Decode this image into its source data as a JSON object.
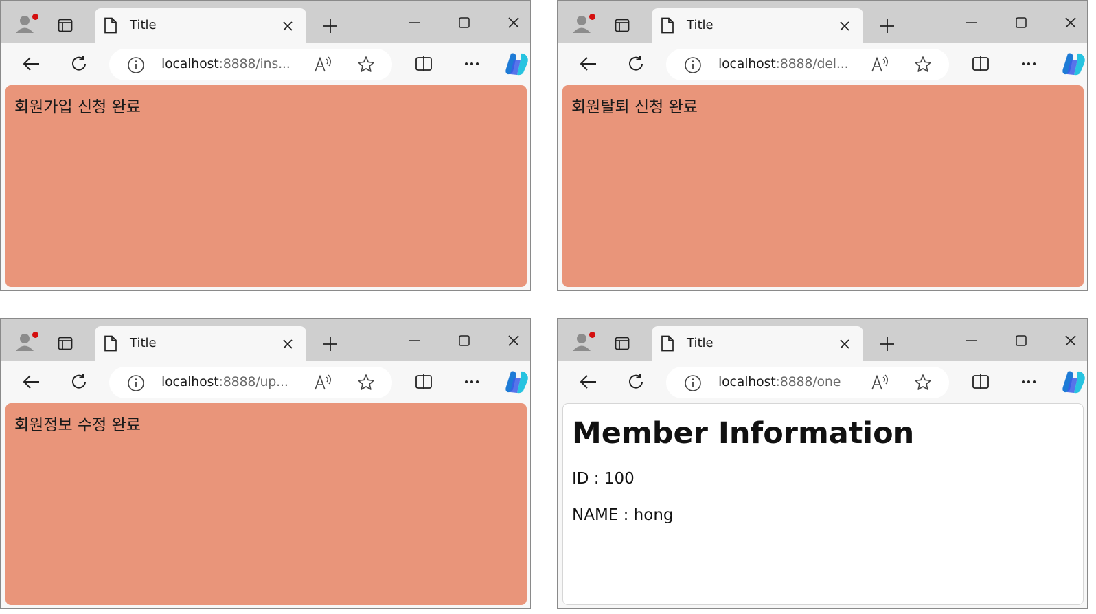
{
  "windows": [
    {
      "tab_title": "Title",
      "url_host": "localhost",
      "url_rest": ":8888/ins...",
      "message": "회원가입 신청 완료"
    },
    {
      "tab_title": "Title",
      "url_host": "localhost",
      "url_rest": ":8888/del...",
      "message": "회원탈퇴 신청 완료"
    },
    {
      "tab_title": "Title",
      "url_host": "localhost",
      "url_rest": ":8888/up...",
      "message": "회원정보 수정 완료"
    },
    {
      "tab_title": "Title",
      "url_host": "localhost",
      "url_rest": ":8888/one",
      "heading": "Member Information",
      "id_line": "ID : 100",
      "name_line": "NAME : hong"
    }
  ],
  "colors": {
    "content_bg": "#e9957a",
    "tabstrip_bg": "#cfcfcf",
    "profile_badge": "#d40f0f"
  },
  "icons": [
    "profile-icon",
    "tab-actions-icon",
    "page-icon",
    "close-icon",
    "plus-icon",
    "minimize-icon",
    "maximize-icon",
    "back-arrow-icon",
    "refresh-icon",
    "info-icon",
    "read-aloud-icon",
    "favorite-star-icon",
    "split-screen-icon",
    "more-icon",
    "copilot-icon"
  ]
}
